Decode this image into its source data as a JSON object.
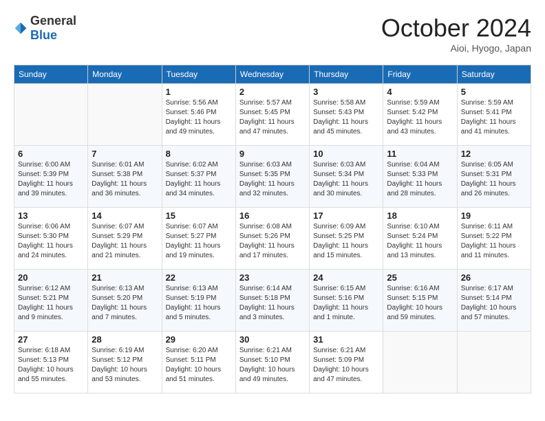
{
  "logo": {
    "general": "General",
    "blue": "Blue"
  },
  "header": {
    "month": "October 2024",
    "location": "Aioi, Hyogo, Japan"
  },
  "weekdays": [
    "Sunday",
    "Monday",
    "Tuesday",
    "Wednesday",
    "Thursday",
    "Friday",
    "Saturday"
  ],
  "weeks": [
    [
      {
        "day": "",
        "info": ""
      },
      {
        "day": "",
        "info": ""
      },
      {
        "day": "1",
        "info": "Sunrise: 5:56 AM\nSunset: 5:46 PM\nDaylight: 11 hours and 49 minutes."
      },
      {
        "day": "2",
        "info": "Sunrise: 5:57 AM\nSunset: 5:45 PM\nDaylight: 11 hours and 47 minutes."
      },
      {
        "day": "3",
        "info": "Sunrise: 5:58 AM\nSunset: 5:43 PM\nDaylight: 11 hours and 45 minutes."
      },
      {
        "day": "4",
        "info": "Sunrise: 5:59 AM\nSunset: 5:42 PM\nDaylight: 11 hours and 43 minutes."
      },
      {
        "day": "5",
        "info": "Sunrise: 5:59 AM\nSunset: 5:41 PM\nDaylight: 11 hours and 41 minutes."
      }
    ],
    [
      {
        "day": "6",
        "info": "Sunrise: 6:00 AM\nSunset: 5:39 PM\nDaylight: 11 hours and 39 minutes."
      },
      {
        "day": "7",
        "info": "Sunrise: 6:01 AM\nSunset: 5:38 PM\nDaylight: 11 hours and 36 minutes."
      },
      {
        "day": "8",
        "info": "Sunrise: 6:02 AM\nSunset: 5:37 PM\nDaylight: 11 hours and 34 minutes."
      },
      {
        "day": "9",
        "info": "Sunrise: 6:03 AM\nSunset: 5:35 PM\nDaylight: 11 hours and 32 minutes."
      },
      {
        "day": "10",
        "info": "Sunrise: 6:03 AM\nSunset: 5:34 PM\nDaylight: 11 hours and 30 minutes."
      },
      {
        "day": "11",
        "info": "Sunrise: 6:04 AM\nSunset: 5:33 PM\nDaylight: 11 hours and 28 minutes."
      },
      {
        "day": "12",
        "info": "Sunrise: 6:05 AM\nSunset: 5:31 PM\nDaylight: 11 hours and 26 minutes."
      }
    ],
    [
      {
        "day": "13",
        "info": "Sunrise: 6:06 AM\nSunset: 5:30 PM\nDaylight: 11 hours and 24 minutes."
      },
      {
        "day": "14",
        "info": "Sunrise: 6:07 AM\nSunset: 5:29 PM\nDaylight: 11 hours and 21 minutes."
      },
      {
        "day": "15",
        "info": "Sunrise: 6:07 AM\nSunset: 5:27 PM\nDaylight: 11 hours and 19 minutes."
      },
      {
        "day": "16",
        "info": "Sunrise: 6:08 AM\nSunset: 5:26 PM\nDaylight: 11 hours and 17 minutes."
      },
      {
        "day": "17",
        "info": "Sunrise: 6:09 AM\nSunset: 5:25 PM\nDaylight: 11 hours and 15 minutes."
      },
      {
        "day": "18",
        "info": "Sunrise: 6:10 AM\nSunset: 5:24 PM\nDaylight: 11 hours and 13 minutes."
      },
      {
        "day": "19",
        "info": "Sunrise: 6:11 AM\nSunset: 5:22 PM\nDaylight: 11 hours and 11 minutes."
      }
    ],
    [
      {
        "day": "20",
        "info": "Sunrise: 6:12 AM\nSunset: 5:21 PM\nDaylight: 11 hours and 9 minutes."
      },
      {
        "day": "21",
        "info": "Sunrise: 6:13 AM\nSunset: 5:20 PM\nDaylight: 11 hours and 7 minutes."
      },
      {
        "day": "22",
        "info": "Sunrise: 6:13 AM\nSunset: 5:19 PM\nDaylight: 11 hours and 5 minutes."
      },
      {
        "day": "23",
        "info": "Sunrise: 6:14 AM\nSunset: 5:18 PM\nDaylight: 11 hours and 3 minutes."
      },
      {
        "day": "24",
        "info": "Sunrise: 6:15 AM\nSunset: 5:16 PM\nDaylight: 11 hours and 1 minute."
      },
      {
        "day": "25",
        "info": "Sunrise: 6:16 AM\nSunset: 5:15 PM\nDaylight: 10 hours and 59 minutes."
      },
      {
        "day": "26",
        "info": "Sunrise: 6:17 AM\nSunset: 5:14 PM\nDaylight: 10 hours and 57 minutes."
      }
    ],
    [
      {
        "day": "27",
        "info": "Sunrise: 6:18 AM\nSunset: 5:13 PM\nDaylight: 10 hours and 55 minutes."
      },
      {
        "day": "28",
        "info": "Sunrise: 6:19 AM\nSunset: 5:12 PM\nDaylight: 10 hours and 53 minutes."
      },
      {
        "day": "29",
        "info": "Sunrise: 6:20 AM\nSunset: 5:11 PM\nDaylight: 10 hours and 51 minutes."
      },
      {
        "day": "30",
        "info": "Sunrise: 6:21 AM\nSunset: 5:10 PM\nDaylight: 10 hours and 49 minutes."
      },
      {
        "day": "31",
        "info": "Sunrise: 6:21 AM\nSunset: 5:09 PM\nDaylight: 10 hours and 47 minutes."
      },
      {
        "day": "",
        "info": ""
      },
      {
        "day": "",
        "info": ""
      }
    ]
  ]
}
